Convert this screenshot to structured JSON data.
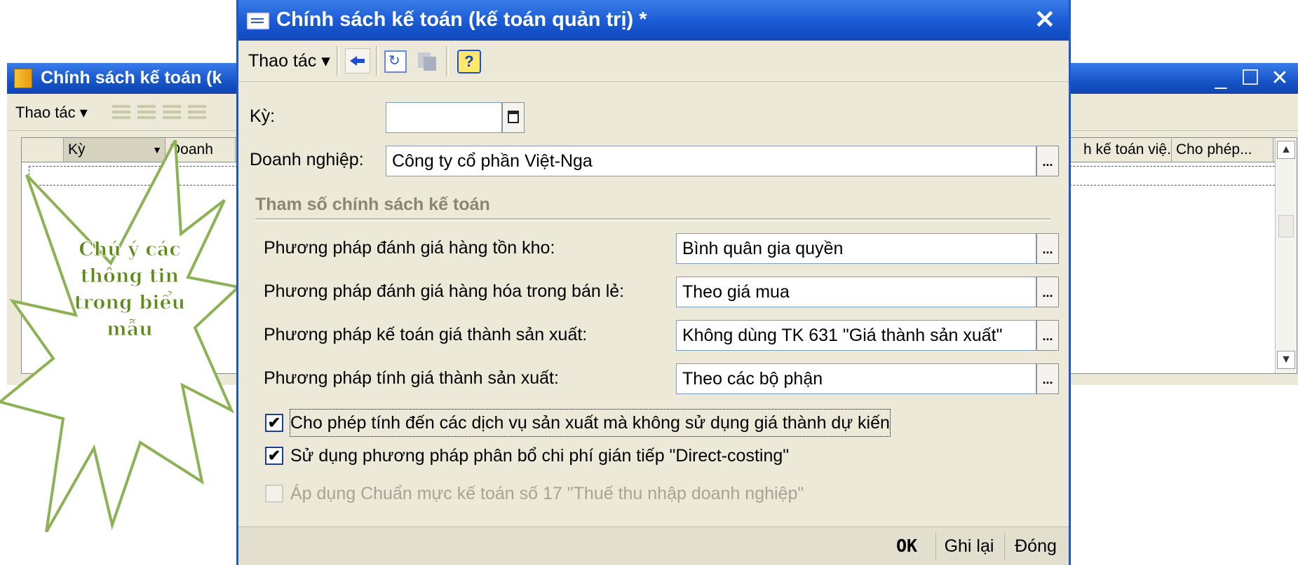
{
  "background_window": {
    "title": "Chính sách kế toán (k",
    "toolbar_action": "Thao tác ▾",
    "grid_columns": [
      "Kỳ",
      "Doanh",
      "h kế toán việ...",
      "Cho phép..."
    ],
    "minimize_icon": "minimize-icon",
    "maximize_icon": "maximize-icon",
    "close_icon": "close-icon"
  },
  "callout": {
    "lines": [
      "Chú ý các",
      "thông tin",
      "trong biểu",
      "mẫu"
    ],
    "color": "#8db255"
  },
  "dialog": {
    "title": "Chính sách kế toán (kế toán quản trị) *",
    "toolbar": {
      "action_label": "Thao tác ▾",
      "icons": [
        "back-arrow-icon",
        "refresh-icon",
        "copy-icon",
        "help-icon"
      ],
      "help_glyph": "?"
    },
    "fields": {
      "period_label": "Kỳ:",
      "period_value": "",
      "company_label": "Doanh nghiệp:",
      "company_value": "Công ty cổ phần Việt-Nga"
    },
    "group_title": "Tham số chính sách kế toán",
    "params": [
      {
        "label": "Phương pháp đánh giá hàng tồn kho:",
        "value": "Bình quân gia quyền"
      },
      {
        "label": "Phương pháp đánh giá hàng hóa trong bán lẻ:",
        "value": "Theo giá mua"
      },
      {
        "label": "Phương pháp kế toán giá thành sản xuất:",
        "value": "Không dùng TK 631 \"Giá thành sản xuất\""
      },
      {
        "label": "Phương pháp tính giá thành sản xuất:",
        "value": "Theo các bộ phận"
      }
    ],
    "checkboxes": [
      {
        "label": "Cho phép tính đến các dịch vụ sản xuất mà không sử dụng giá thành dự kiến",
        "checked": true,
        "enabled": true
      },
      {
        "label": "Sử dụng phương pháp phân bổ chi phí gián tiếp \"Direct-costing\"",
        "checked": true,
        "enabled": true
      },
      {
        "label": "Áp dụng Chuẩn mực kế toán số 17 \"Thuế thu nhập doanh nghiệp\"",
        "checked": false,
        "enabled": false
      }
    ],
    "check_glyph": "✔",
    "ellipsis": "...",
    "close_glyph": "✕",
    "footer": {
      "ok": "OK",
      "save": "Ghi lại",
      "close": "Đóng"
    }
  },
  "colors": {
    "titlebar": "#1a5ad4",
    "dialog_bg": "#ece9d8",
    "callout_green": "#8db255"
  }
}
